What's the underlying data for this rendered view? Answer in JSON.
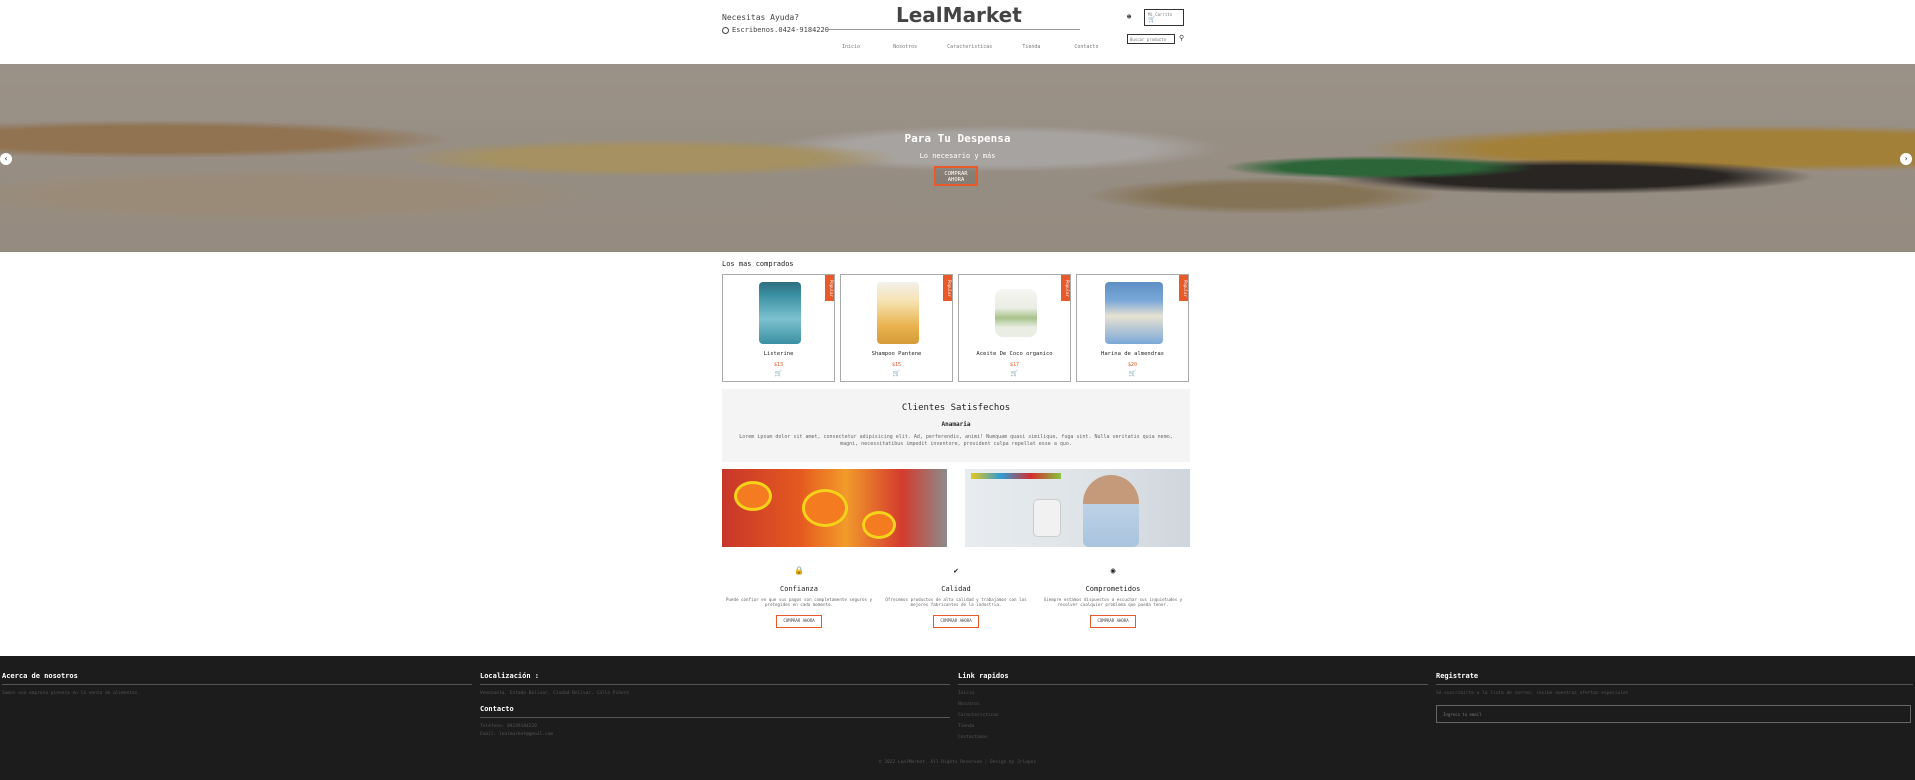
{
  "header": {
    "help_text": "Necesitas Ayuda?",
    "whatsapp_text": "Escribenos.0424-9184220",
    "logo": "LealMarket",
    "nav": [
      "Inicio",
      "Nosotros",
      "Caracteristicas",
      "Tienda",
      "Contacto"
    ],
    "user_icon": "user-icon",
    "cart_label": "Mi Carrito",
    "search_placeholder": "Buscar producto"
  },
  "hero": {
    "title": "Para Tu Despensa",
    "subtitle": "Lo necesario y más",
    "button": "COMPRAR AHORA"
  },
  "most_bought": {
    "title": "Los mas comprados",
    "products": [
      {
        "name": "Listerine",
        "price": "$13",
        "badge": "Popular",
        "color": "#3a8fa3"
      },
      {
        "name": "Shampoo Pantene",
        "price": "$15",
        "badge": "Popular",
        "color": "#e9b451"
      },
      {
        "name": "Aceite De Coco organico",
        "price": "$17",
        "badge": "Popular",
        "color": "#e9ede3"
      },
      {
        "name": "Harina de almendras",
        "price": "$20",
        "badge": "Popular",
        "color": "#7aa8d8"
      }
    ]
  },
  "testimonial": {
    "title": "Clientes Satisfechos",
    "name": "Anamaria",
    "text": "Lorem ipsum dolor sit amet, consectetur adipisicing elit. Ad, perferendis, animi! Numquam quasi similique, fuga sint. Nulla veritatis quia nemo, magni, necessitatibus impedit inventore, provident culpa repellat esse a quo."
  },
  "features": [
    {
      "icon": "lock-icon",
      "title": "Confianza",
      "text": "Puede confiar en que sus pagos son completamente seguros y protegidos en cada momento.",
      "button": "COMPRAR AHORA"
    },
    {
      "icon": "shield-check-icon",
      "title": "Calidad",
      "text": "Ofrecemos productos de alta calidad y trabajamos con las mejores fabricantes de la industria.",
      "button": "COMPRAR AHORA"
    },
    {
      "icon": "wifi-icon",
      "title": "Comprometidos",
      "text": "Siempre estamos dispuestos a escuchar sus inquietudes y resolver cualquier problema que pueda tener.",
      "button": "COMPRAR AHORA"
    }
  ],
  "footer": {
    "about_title": "Acerca de nosotros",
    "about_text": "Somos una empresa pionera en la venta de alimentos.",
    "location_title": "Localización :",
    "location_text": "Venezuela, Estado Bolivar, Ciudad Bolivar, Calle Piñero",
    "contact_title": "Contacto",
    "contact_phone": "Teléfono: 04249184220",
    "contact_email": "Email: lealmarket@gmail.com",
    "links_title": "Link rapidos",
    "links": [
      "Inicio",
      "Nosotros",
      "Caracteristicas",
      "Tienda",
      "Contactanos"
    ],
    "register_title": "Registrate",
    "register_text": "Sé suscribirte a la lista de correo, recibe nuestras ofertas especiales",
    "register_placeholder": "Ingresa tu email",
    "copyright": "© 2022 LealMarket. All Rights Reserved | Design by Jrlopez"
  },
  "colors": {
    "accent": "#e85a2a",
    "footer_bg": "#1c1c1c",
    "testimonial_bg": "#f4f4f4"
  }
}
